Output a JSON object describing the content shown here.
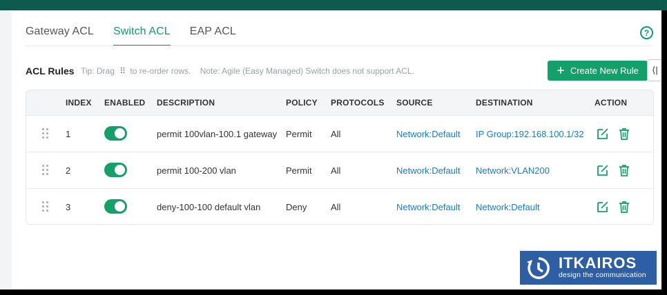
{
  "tabs": [
    {
      "label": "Gateway ACL",
      "active": false
    },
    {
      "label": "Switch ACL",
      "active": true
    },
    {
      "label": "EAP ACL",
      "active": false
    }
  ],
  "help_icon": "question-circle-icon",
  "section": {
    "title": "ACL Rules",
    "tip_prefix": "Tip: Drag",
    "tip_suffix": "to re-order rows.",
    "note": "Note: Agile (Easy Managed) Switch does not support ACL."
  },
  "create_button": {
    "label": "Create New Rule",
    "icon": "plus-icon"
  },
  "collapse_label": "⟨|",
  "table": {
    "headers": [
      "INDEX",
      "ENABLED",
      "DESCRIPTION",
      "POLICY",
      "PROTOCOLS",
      "SOURCE",
      "DESTINATION",
      "ACTION"
    ],
    "rows": [
      {
        "index": "1",
        "enabled": true,
        "description": "permit 100vlan-100.1 gateway",
        "policy": "Permit",
        "protocols": "All",
        "source": "Network:Default",
        "destination": "IP Group:192.168.100.1/32"
      },
      {
        "index": "2",
        "enabled": true,
        "description": "permit 100-200 vlan",
        "policy": "Permit",
        "protocols": "All",
        "source": "Network:Default",
        "destination": "Network:VLAN200"
      },
      {
        "index": "3",
        "enabled": true,
        "description": "deny-100-100 default vlan",
        "policy": "Deny",
        "protocols": "All",
        "source": "Network:Default",
        "destination": "Network:Default"
      }
    ]
  },
  "logo": {
    "name": "ITKAIROS",
    "tagline": "design the communication"
  },
  "colors": {
    "accent": "#13a06b",
    "link": "#1a7ac9",
    "topbar": "#0f5a4e",
    "logo_bg": "#2e5ea3"
  }
}
